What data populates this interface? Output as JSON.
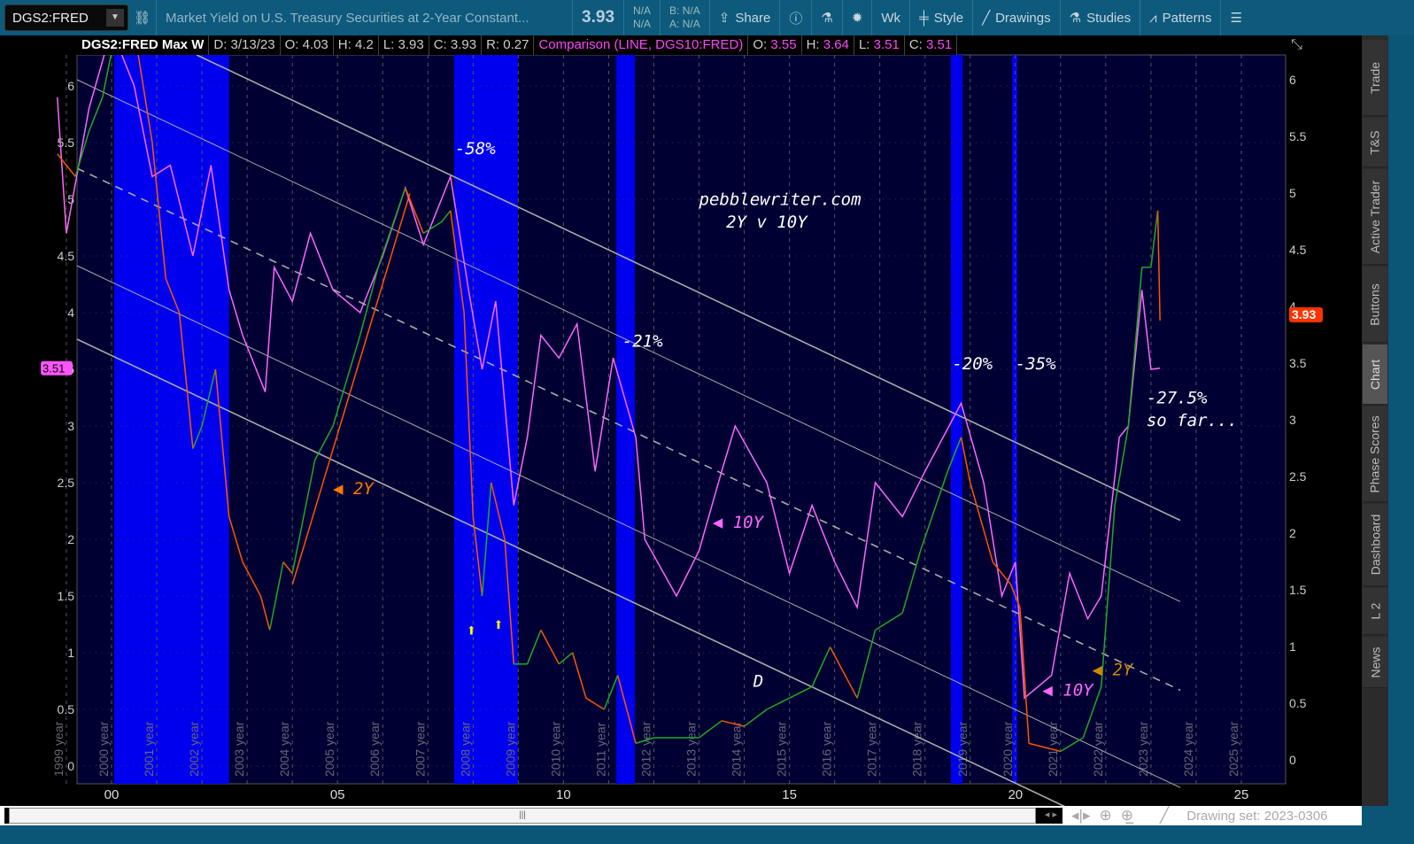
{
  "toolbar": {
    "symbol": "DGS2:FRED",
    "description": "Market Yield on U.S. Treasury Securities at 2-Year Constant...",
    "last": "3.93",
    "na1": "N/A",
    "na2": "N/A",
    "bid": "B: N/A",
    "ask": "A: N/A",
    "share": "Share",
    "period": "Wk",
    "style": "Style",
    "drawings": "Drawings",
    "studies": "Studies",
    "patterns": "Patterns"
  },
  "infobar": {
    "title": "DGS2:FRED Max W",
    "d": "D: 3/13/23",
    "o": "O: 4.03",
    "h": "H: 4.2",
    "l": "L: 3.93",
    "c": "C: 3.93",
    "r": "R: 0.27",
    "comp": "Comparison (LINE, DGS10:FRED)",
    "co": "O:",
    "cov": "3.55",
    "ch": "H:",
    "chv": "3.64",
    "cl": "L:",
    "clv": "3.51",
    "cc": "C:",
    "ccv": "3.51"
  },
  "sidebar": [
    "Trade",
    "T&S",
    "Active Trader",
    "Buttons",
    "Chart",
    "Phase Scores",
    "Dashboard",
    "L 2",
    "News"
  ],
  "bottom": {
    "drawing_set": "Drawing set: 2023-0306",
    "scroll_grip": "|||"
  },
  "colors": {
    "bg": "#000033",
    "recession": "#0000ee",
    "ten_year": "#ff66ff",
    "two_up": "#22aa22",
    "two_down": "#ff5500",
    "price_tag": "#ff3300"
  },
  "chart_data": {
    "type": "line",
    "y_ticks": [
      "0",
      "0.5",
      "1",
      "1.5",
      "2",
      "2.5",
      "3",
      "3.5",
      "4",
      "4.5",
      "5",
      "5.5",
      "6"
    ],
    "y_tick_values": [
      0,
      0.5,
      1,
      1.5,
      2,
      2.5,
      3,
      3.5,
      4,
      4.5,
      5,
      5.5,
      6
    ],
    "x_ticks": [
      {
        "label": "00",
        "year": 2000
      },
      {
        "label": "05",
        "year": 2005
      },
      {
        "label": "10",
        "year": 2010
      },
      {
        "label": "15",
        "year": 2015
      },
      {
        "label": "20",
        "year": 2020
      },
      {
        "label": "25",
        "year": 2025
      }
    ],
    "year_labels": [
      "1999 year",
      "2000 year",
      "2001 year",
      "2002 year",
      "2003 year",
      "2004 year",
      "2005 year",
      "2006 year",
      "2007 year",
      "2008 year",
      "2009 year",
      "2010 year",
      "2011 year",
      "2012 year",
      "2013 year",
      "2014 year",
      "2015 year",
      "2016 year",
      "2017 year",
      "2018 year",
      "2019 year",
      "2020 year",
      "2021 year",
      "2022 year",
      "2023 year",
      "2024 year",
      "2025 year"
    ],
    "price_tag_right": "3.93",
    "price_tag_left": "3.51",
    "shaded_periods": [
      [
        2000.06,
        2002.6
      ],
      [
        2007.58,
        2008.99
      ],
      [
        2011.17,
        2011.58
      ],
      [
        2018.57,
        2018.83
      ],
      [
        2019.93,
        2020.04
      ]
    ],
    "series": [
      {
        "name": "DGS2",
        "x": [
          1998.8,
          1999.2,
          1999.5,
          1999.8,
          2000.0,
          2000.5,
          2000.9,
          2001.2,
          2001.5,
          2001.8,
          2002.0,
          2002.3,
          2002.6,
          2002.9,
          2003.3,
          2003.5,
          2003.8,
          2004.0,
          2004.5,
          2004.9,
          2005.5,
          2005.9,
          2006.5,
          2006.9,
          2007.3,
          2007.5,
          2007.8,
          2008.0,
          2008.2,
          2008.4,
          2008.7,
          2008.9,
          2009.2,
          2009.5,
          2009.9,
          2010.2,
          2010.5,
          2010.9,
          2011.2,
          2011.6,
          2012.0,
          2013.0,
          2013.5,
          2014.0,
          2014.5,
          2015.0,
          2015.5,
          2015.9,
          2016.5,
          2016.9,
          2017.5,
          2017.9,
          2018.5,
          2018.8,
          2019.0,
          2019.5,
          2019.9,
          2020.1,
          2020.3,
          2021.0,
          2021.5,
          2021.9,
          2022.2,
          2022.5,
          2022.8,
          2023.0,
          2023.15,
          2023.2
        ],
        "y": [
          5.4,
          5.2,
          5.6,
          5.9,
          6.3,
          6.5,
          5.5,
          4.3,
          4.0,
          2.8,
          3.0,
          3.5,
          2.2,
          1.8,
          1.5,
          1.2,
          1.8,
          1.7,
          2.7,
          3.0,
          3.8,
          4.4,
          5.1,
          4.7,
          4.8,
          4.9,
          4.0,
          2.2,
          1.5,
          2.5,
          2.0,
          0.9,
          0.9,
          1.2,
          0.9,
          1.0,
          0.6,
          0.5,
          0.8,
          0.2,
          0.25,
          0.25,
          0.4,
          0.35,
          0.5,
          0.6,
          0.7,
          1.05,
          0.6,
          1.2,
          1.35,
          1.9,
          2.6,
          2.9,
          2.5,
          1.8,
          1.6,
          1.4,
          0.2,
          0.13,
          0.25,
          0.7,
          2.3,
          3.0,
          4.4,
          4.4,
          4.9,
          3.93
        ]
      },
      {
        "name": "DGS10",
        "x": [
          1998.8,
          1999.0,
          1999.5,
          2000.0,
          2000.5,
          2000.9,
          2001.3,
          2001.8,
          2002.2,
          2002.6,
          2002.9,
          2003.4,
          2003.6,
          2004.0,
          2004.4,
          2004.9,
          2005.5,
          2006.0,
          2006.5,
          2006.9,
          2007.5,
          2007.9,
          2008.2,
          2008.5,
          2008.9,
          2009.2,
          2009.5,
          2009.9,
          2010.3,
          2010.7,
          2011.1,
          2011.6,
          2011.8,
          2012.5,
          2013.0,
          2013.5,
          2013.8,
          2014.5,
          2015.0,
          2015.5,
          2016.0,
          2016.5,
          2016.9,
          2017.5,
          2018.0,
          2018.8,
          2019.3,
          2019.7,
          2020.0,
          2020.2,
          2020.8,
          2021.2,
          2021.6,
          2021.9,
          2022.3,
          2022.5,
          2022.8,
          2023.0,
          2023.2
        ],
        "y": [
          5.9,
          4.7,
          5.8,
          6.5,
          6.0,
          5.2,
          5.3,
          4.5,
          5.3,
          4.2,
          3.8,
          3.3,
          4.4,
          4.1,
          4.7,
          4.2,
          4.0,
          4.5,
          5.1,
          4.6,
          5.2,
          4.2,
          3.5,
          4.1,
          2.3,
          2.9,
          3.8,
          3.6,
          3.9,
          2.6,
          3.6,
          2.9,
          2.0,
          1.5,
          1.9,
          2.6,
          3.0,
          2.5,
          1.7,
          2.3,
          1.8,
          1.4,
          2.5,
          2.2,
          2.6,
          3.2,
          2.5,
          1.5,
          1.8,
          0.6,
          0.8,
          1.7,
          1.3,
          1.5,
          2.9,
          3.0,
          4.2,
          3.5,
          3.51
        ]
      }
    ],
    "annotations": [
      {
        "text": "-58%",
        "year": 2007.6,
        "value": 5.4,
        "color": "#ffffff"
      },
      {
        "text": "pebblewriter.com",
        "year": 2013.0,
        "value": 4.95,
        "color": "#ffffff",
        "italic": false
      },
      {
        "text": "2Y v 10Y",
        "year": 2013.6,
        "value": 4.75,
        "color": "#ffffff",
        "italic": false
      },
      {
        "text": "-21%",
        "year": 2011.3,
        "value": 3.7,
        "color": "#ffffff"
      },
      {
        "text": "-20%",
        "year": 2018.6,
        "value": 3.5,
        "color": "#ffffff"
      },
      {
        "text": "-35%",
        "year": 2020.0,
        "value": 3.5,
        "color": "#ffffff"
      },
      {
        "text": "-27.5%",
        "year": 2022.9,
        "value": 3.2,
        "color": "#ffffff"
      },
      {
        "text": "so far...",
        "year": 2022.9,
        "value": 3.0,
        "color": "#ffffff"
      },
      {
        "text": "◀ 2Y",
        "year": 2004.9,
        "value": 2.4,
        "color": "#ff7700"
      },
      {
        "text": "◀ 10Y",
        "year": 2013.3,
        "value": 2.1,
        "color": "#ff66ff"
      },
      {
        "text": "D",
        "year": 2014.2,
        "value": 0.7,
        "color": "#ffffff",
        "italic": false
      },
      {
        "text": "◀ 10Y",
        "year": 2020.6,
        "value": 0.62,
        "color": "#ff66ff"
      },
      {
        "text": "◀ 2Y",
        "year": 2021.7,
        "value": 0.8,
        "color": "#cc8800"
      },
      {
        "text": "⬆",
        "year": 2007.85,
        "value": 1.15,
        "color": "#ffff00",
        "italic": false
      },
      {
        "text": "⬆",
        "year": 2008.45,
        "value": 1.2,
        "color": "#ffff00",
        "italic": false
      }
    ]
  }
}
